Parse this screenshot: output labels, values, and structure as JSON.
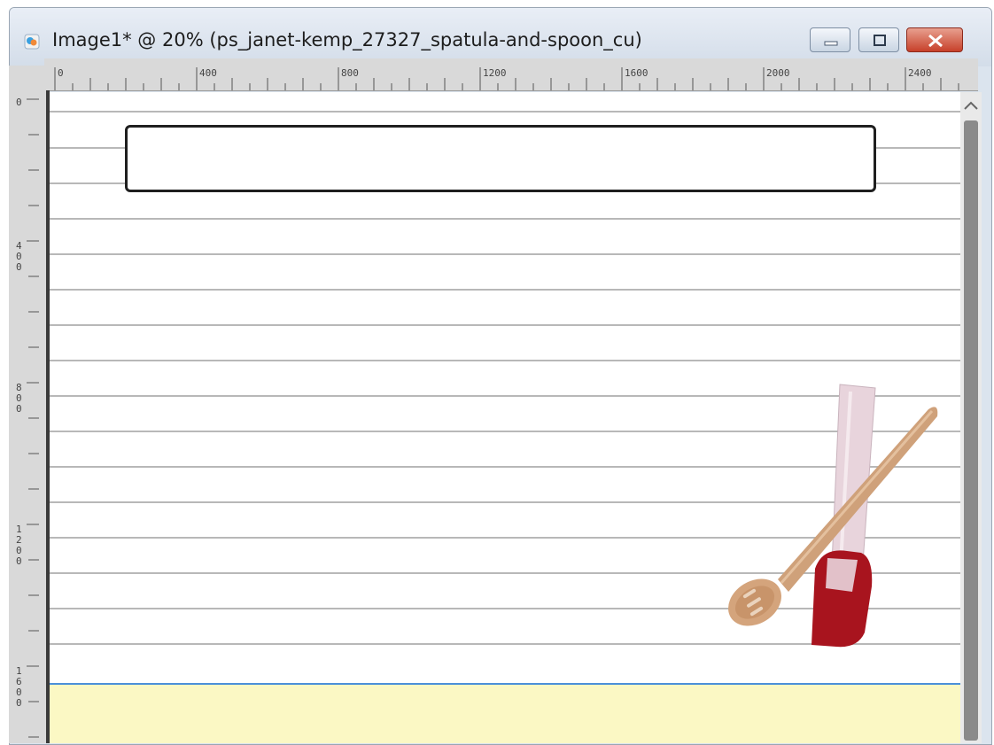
{
  "window": {
    "title": "Image1* @  20% (ps_janet-kemp_27327_spatula-and-spoon_cu)",
    "controls": [
      "minimize",
      "maximize",
      "close"
    ]
  },
  "ruler_top": {
    "labels": [
      "0",
      "400",
      "800",
      "1200",
      "1600",
      "2000",
      "2400"
    ]
  },
  "ruler_left": {
    "labels": [
      "0",
      "400",
      "800",
      "1200",
      "1600"
    ]
  },
  "canvas": {
    "background": "#ffffff",
    "rule_line_color": "#b8b8b8",
    "title_box_border": "#1f1f1f",
    "footer_band_color": "#fbf8c4",
    "footer_line_color": "#4a90d9",
    "clipart": "spatula-and-spoon"
  },
  "icons": {
    "app": "psp-image-icon",
    "minimize": "minimize-icon",
    "maximize": "maximize-icon",
    "close": "close-icon",
    "scroll_up": "chevron-up-icon"
  }
}
